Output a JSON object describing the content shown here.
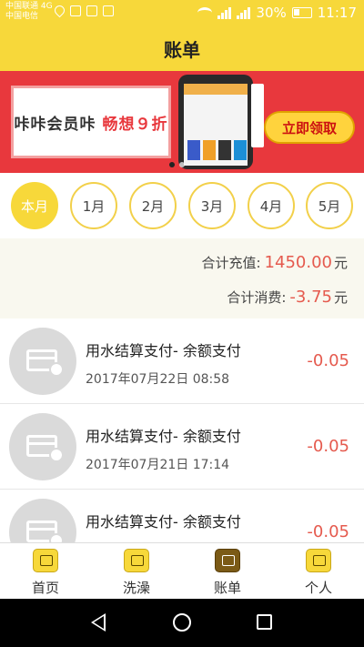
{
  "status_bar": {
    "carrier1": "中国联通 4G",
    "carrier2": "中国电信",
    "battery": "30%",
    "time": "11:17"
  },
  "header": {
    "title": "账单"
  },
  "banner": {
    "text_plain": "咔咔会员咔 ",
    "text_highlight": "畅想９折",
    "button": "立即领取",
    "slide_count": 2,
    "active_slide": 1
  },
  "months": [
    {
      "label": "本月",
      "active": true
    },
    {
      "label": "1月",
      "active": false
    },
    {
      "label": "2月",
      "active": false
    },
    {
      "label": "3月",
      "active": false
    },
    {
      "label": "4月",
      "active": false
    },
    {
      "label": "5月",
      "active": false
    }
  ],
  "summary": {
    "recharge_label": "合计充值:",
    "recharge_value": "1450.00",
    "recharge_unit": "元",
    "spend_label": "合计消费:",
    "spend_value": "-3.75",
    "spend_unit": "元"
  },
  "transactions": [
    {
      "title": "用水结算支付-  余额支付",
      "date": "2017年07月22日  08:58",
      "amount": "-0.05",
      "icon": "card-refund-icon"
    },
    {
      "title": "用水结算支付-  余额支付",
      "date": "2017年07月21日  17:14",
      "amount": "-0.05",
      "icon": "card-refund-icon"
    },
    {
      "title": "用水结算支付-  余额支付",
      "date": "",
      "amount": "-0.05",
      "icon": "card-refund-icon"
    }
  ],
  "tabs": [
    {
      "label": "首页",
      "icon": "home-icon",
      "active": false
    },
    {
      "label": "洗澡",
      "icon": "shower-icon",
      "active": false
    },
    {
      "label": "账单",
      "icon": "bill-icon",
      "active": true
    },
    {
      "label": "个人",
      "icon": "profile-icon",
      "active": false
    }
  ],
  "colors": {
    "accent_yellow": "#f7d83a",
    "amount_red": "#e55a4e",
    "banner_red": "#e8383d"
  }
}
